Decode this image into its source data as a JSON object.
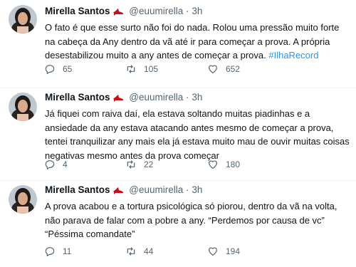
{
  "tweets": [
    {
      "author_name": "Mirella Santos",
      "handle": "@euumirella",
      "separator": "·",
      "time": "3h",
      "text": "O fato é que esse surto não foi do nada. Rolou uma pressão muito forte na cabeça da Any dentro da vã até ir para começar a prova. A própria desestabilizou muito a any antes de começar a prova.",
      "hashtag": "#IlhaRecord",
      "replies": "65",
      "retweets": "105",
      "likes": "652"
    },
    {
      "author_name": "Mirella Santos",
      "handle": "@euumirella",
      "separator": "·",
      "time": "3h",
      "text": "Já fiquei com raiva daí, ela estava soltando muitas piadinhas e a ansiedade da any estava atacando antes mesmo de começar a prova, tentei tranquilizar any mais ela já estava muito mau de ouvir muitas coisas negativas mesmo antes da prova começar",
      "hashtag": "",
      "replies": "4",
      "retweets": "22",
      "likes": "180"
    },
    {
      "author_name": "Mirella Santos",
      "handle": "@euumirella",
      "separator": "·",
      "time": "3h",
      "text": "A prova acabou e a tortura psicológica só piorou, dentro da vã na volta, não parava de falar com a pobre a any. “Perdemos por causa de vc” “Péssima comandate”",
      "hashtag": "",
      "replies": "11",
      "retweets": "44",
      "likes": "194"
    }
  ],
  "icons": {
    "verified_emoji": "high-heel-shoe-icon",
    "reply": "reply-icon",
    "retweet": "retweet-icon",
    "like": "heart-icon"
  },
  "colors": {
    "text": "#0f1419",
    "secondary": "#536471",
    "link": "#1d9bf0",
    "heel": "#c4121c"
  }
}
